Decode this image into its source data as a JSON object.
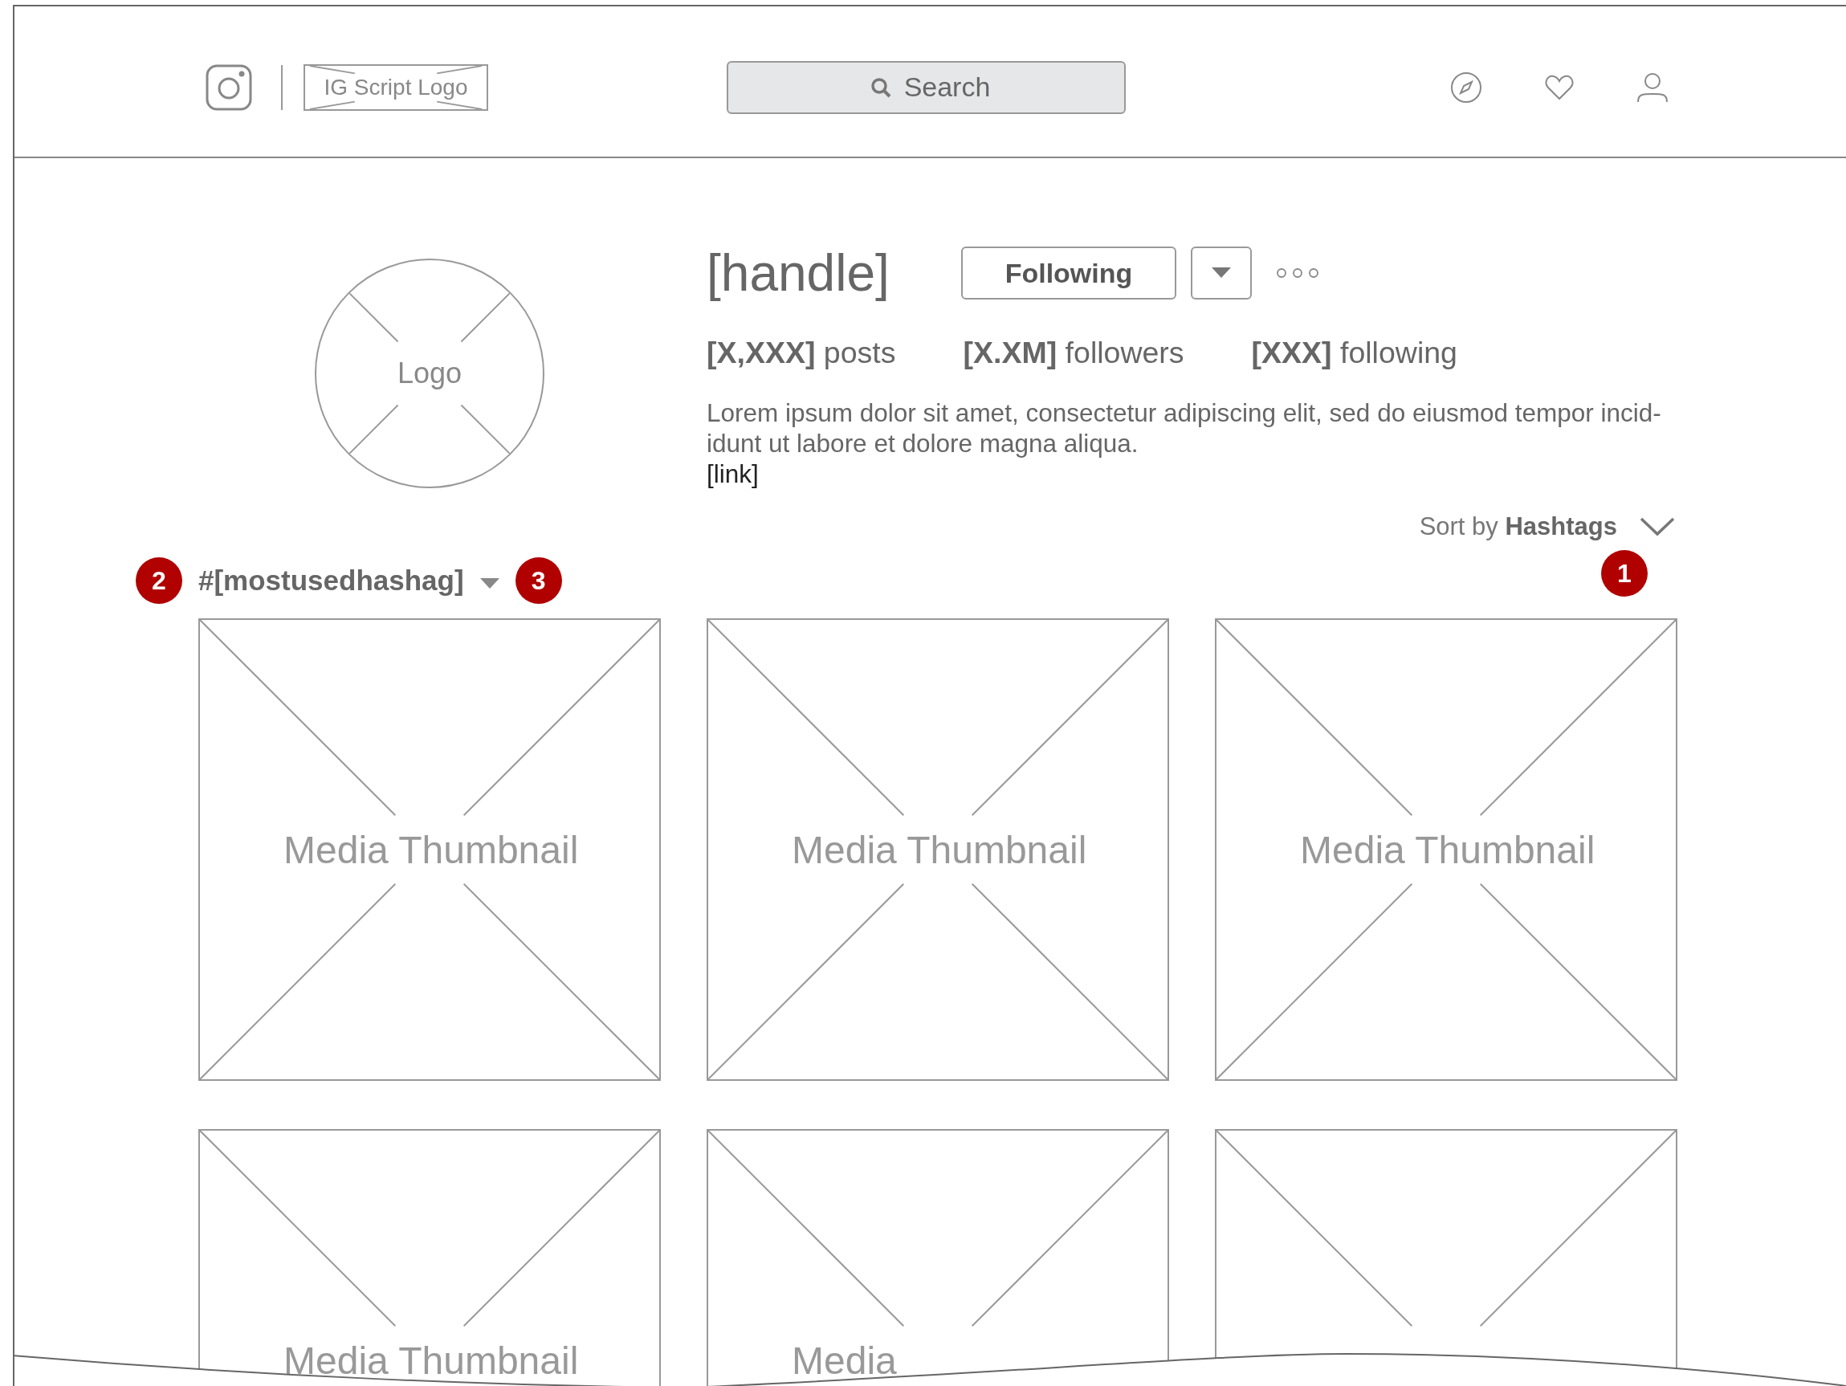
{
  "header": {
    "logo_text": "IG Script Logo",
    "search": {
      "placeholder": "Search"
    }
  },
  "profile": {
    "avatar_text": "Logo",
    "handle": "[handle]",
    "follow_button": "Following",
    "stats": [
      "**[X,XXX]** posts",
      "**[X.XM]** followers",
      "**[XXX]** following"
    ],
    "bio": "Lorem ipsum dolor sit amet, consectetur adipiscing elit, sed do eiusmod tempor incid-idunt ut labore et dolore magna aliqua.",
    "link": "[link]"
  },
  "sort": {
    "text": "Sort by **Hashtags**",
    "badge": "1"
  },
  "filter": {
    "badge_before": "2",
    "hashtag": "#[mostusedhashag]",
    "badge_after": "3"
  },
  "thumbnails": [
    {
      "kind": "media",
      "label": "Media Thumbnail"
    },
    {
      "kind": "media",
      "label": "Media Thumbnail"
    },
    {
      "kind": "media",
      "label": "Media Thumbnail"
    },
    {
      "kind": "media",
      "label": "Media Thumbnail"
    },
    {
      "kind": "media",
      "label": "Media"
    },
    {
      "kind": "media"
    }
  ]
}
